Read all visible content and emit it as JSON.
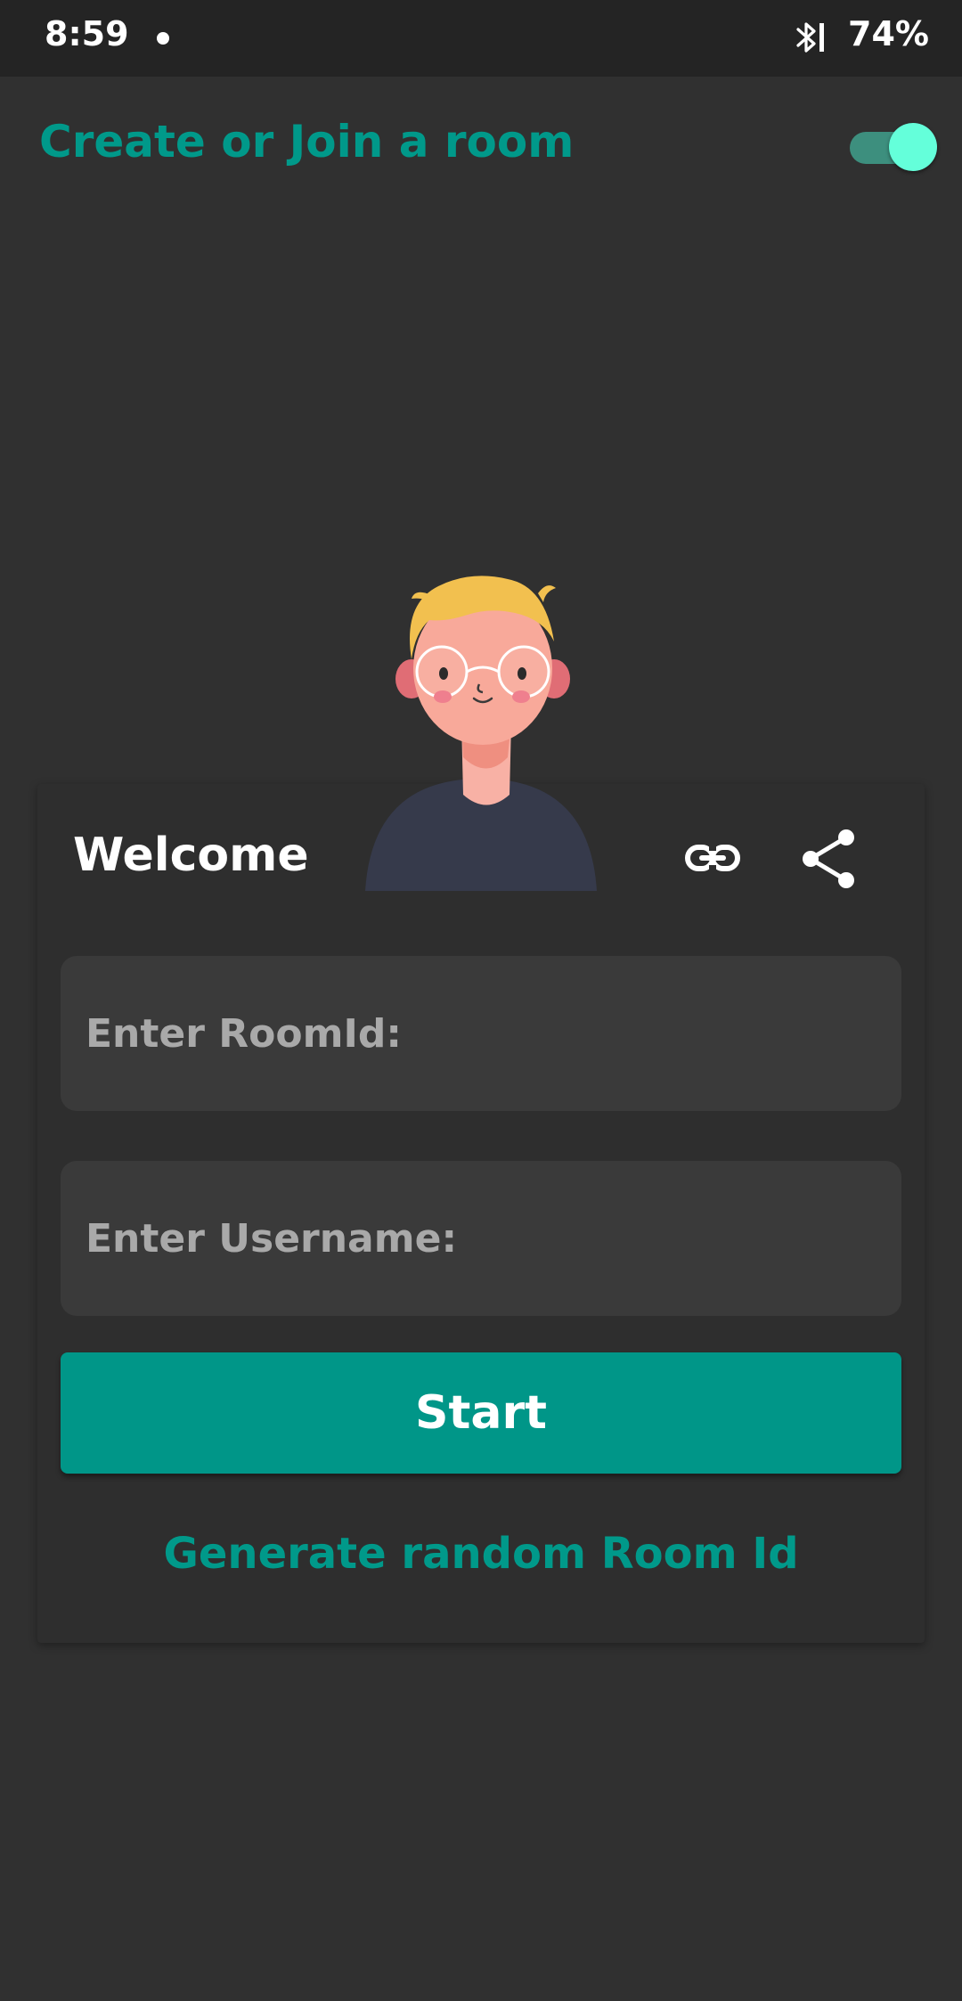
{
  "status_bar": {
    "time": "8:59",
    "battery": "74%",
    "icons": [
      "notification-dot-icon",
      "bluetooth-icon"
    ]
  },
  "header": {
    "title": "Create or Join a room",
    "theme_toggle": {
      "on": true
    }
  },
  "card": {
    "title": "Welcome",
    "icons": [
      "link-icon",
      "share-icon"
    ],
    "roomid": {
      "placeholder": "Enter RoomId:",
      "value": ""
    },
    "username": {
      "placeholder": "Enter Username:",
      "value": ""
    },
    "start_label": "Start",
    "generate_label": "Generate random Room Id"
  },
  "colors": {
    "accent": "#009688",
    "background": "#303030",
    "card": "#2e2e2e",
    "field": "#3a3a3a",
    "toggle_knob": "#64ffda"
  }
}
